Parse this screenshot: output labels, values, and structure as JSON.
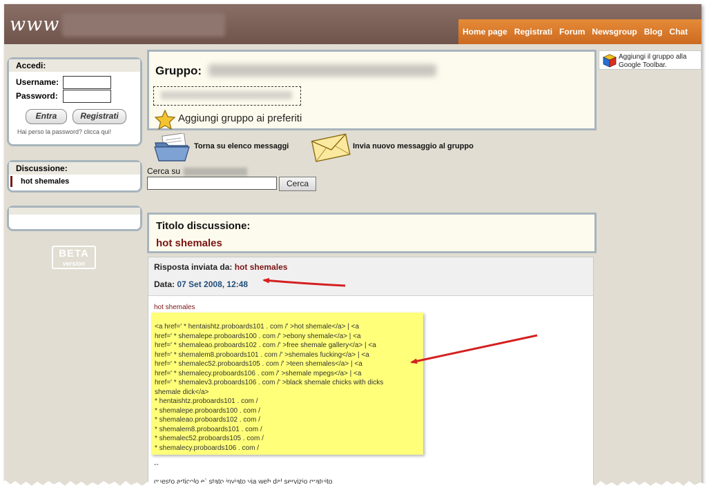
{
  "header": {
    "logo_text": "www",
    "nav": [
      "Home page",
      "Registrati",
      "Forum",
      "Newsgroup",
      "Blog",
      "Chat"
    ]
  },
  "login": {
    "title": "Accedi:",
    "username_label": "Username:",
    "password_label": "Password:",
    "enter_button": "Entra",
    "register_button": "Registrati",
    "forgot_text": "Hai perso la password? clicca qui!"
  },
  "discussion": {
    "title": "Discussione:",
    "item": "hot shemales"
  },
  "beta": {
    "line1": "BETA",
    "line2": "version"
  },
  "group": {
    "label": "Gruppo:",
    "add_favorites": "Aggiungi gruppo ai preferiti"
  },
  "actions": {
    "back_to_list": "Torna su elenco messaggi",
    "new_message": "Invia nuovo messaggio al gruppo"
  },
  "search": {
    "label": "Cerca su",
    "button": "Cerca",
    "value": ""
  },
  "thread": {
    "title_label": "Titolo discussione:",
    "title_value": "hot shemales"
  },
  "reply": {
    "sent_by_label": "Risposta inviata da:",
    "sent_by_value": "hot shemales",
    "date_label": "Data:",
    "date_value": "07 Set 2008, 12:48",
    "message_title": "hot shemales",
    "body_lines": [
      "<a href=' * hentaishtz.proboards101 . com /' >hot shemale</a> | <a",
      "href=' * shemalepe.proboards100 . com /' >ebony shemale</a> | <a",
      "href=' * shemaleao.proboards102 . com /' >free shemale gallery</a> | <a",
      "href=' * shemalem8.proboards101 . com /' >shemales fucking</a> | <a",
      "href=' * shemalec52.proboards105 . com /' >teen shemales</a> | <a",
      "href=' * shemalecy.proboards106 . com /' >shemale mpegs</a> | <a",
      "href=' * shemalev3.proboards106 . com /' >black shemale chicks with dicks",
      "shemale dick</a>",
      "* hentaishtz.proboards101 . com /",
      "* shemalepe.proboards100 . com /",
      "* shemaleao.proboards102 . com /",
      "* shemalem8.proboards101 . com /",
      "* shemalec52.proboards105 . com /",
      "* shemalecy.proboards106 . com /"
    ],
    "sig_dash": "--",
    "sig_text": "questo articolo e` stato inviato via web dal servizio gratuito"
  },
  "toolbar": {
    "text": "Aggiungi il gruppo alla Google Toolbar."
  },
  "colors": {
    "header_brown": "#7a5e55",
    "nav_orange": "#d9772b",
    "highlight_yellow": "#ffff7a",
    "annotation_red": "#d42020",
    "accent_maroon": "#7a1414"
  }
}
